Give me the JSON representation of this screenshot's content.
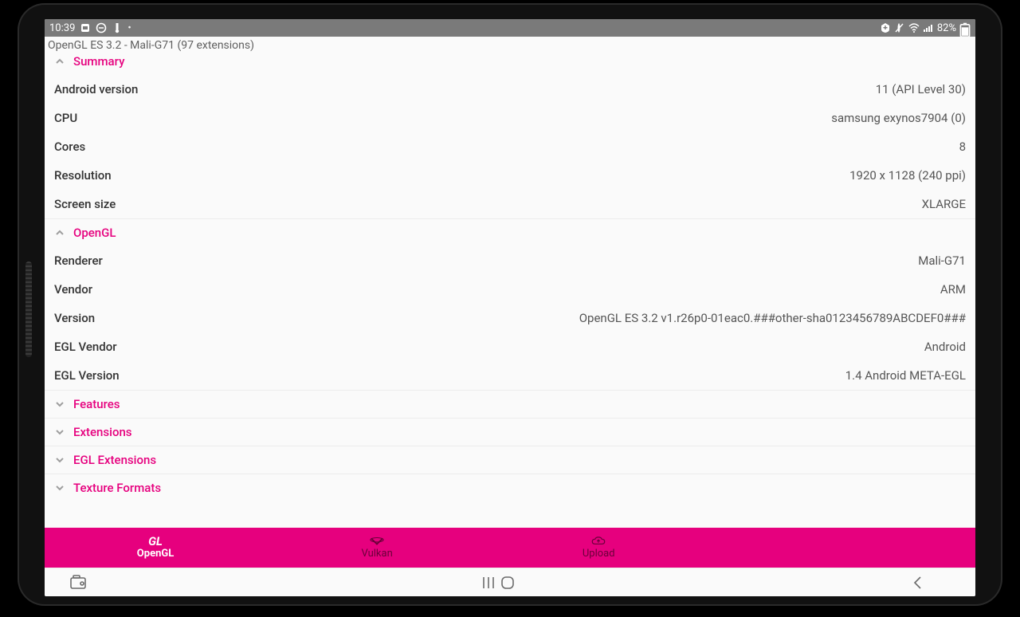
{
  "status": {
    "time": "10:39",
    "battery": "82%"
  },
  "subtitle": "OpenGL ES 3.2 - Mali-G71 (97 extensions)",
  "sections": {
    "summary": {
      "title": "Summary",
      "rows": [
        {
          "label": "Android version",
          "value": "11 (API Level 30)"
        },
        {
          "label": "CPU",
          "value": "samsung  exynos7904 (0)"
        },
        {
          "label": "Cores",
          "value": "8"
        },
        {
          "label": "Resolution",
          "value": "1920 x 1128 (240 ppi)"
        },
        {
          "label": "Screen size",
          "value": "XLARGE"
        }
      ]
    },
    "opengl": {
      "title": "OpenGL",
      "rows": [
        {
          "label": "Renderer",
          "value": "Mali-G71"
        },
        {
          "label": "Vendor",
          "value": "ARM"
        },
        {
          "label": "Version",
          "value": "OpenGL ES 3.2 v1.r26p0-01eac0.###other-sha0123456789ABCDEF0###"
        },
        {
          "label": "EGL Vendor",
          "value": "Android"
        },
        {
          "label": "EGL Version",
          "value": "1.4 Android META-EGL"
        }
      ]
    },
    "collapsed": [
      {
        "title": "Features"
      },
      {
        "title": "Extensions"
      },
      {
        "title": "EGL Extensions"
      },
      {
        "title": "Texture Formats"
      }
    ]
  },
  "tabs": {
    "gl": {
      "icon": "GL",
      "label": "OpenGL"
    },
    "vulkan": {
      "label": "Vulkan"
    },
    "upload": {
      "label": "Upload"
    }
  }
}
